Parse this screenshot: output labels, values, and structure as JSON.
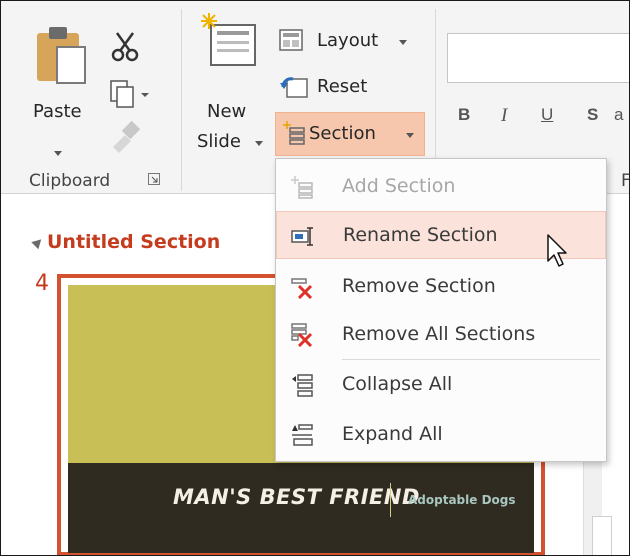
{
  "ribbon": {
    "clipboard": {
      "paste_label": "Paste",
      "group_label": "Clipboard"
    },
    "slides": {
      "new_slide_label_line1": "New",
      "new_slide_label_line2": "Slide",
      "layout_label": "Layout",
      "reset_label": "Reset",
      "section_label": "Section"
    },
    "font": {
      "bold_label": "B",
      "italic_label": "I",
      "underline_label": "U",
      "strike_label": "S",
      "group_partial": "F",
      "partial_char": "a"
    }
  },
  "section_menu": {
    "items": [
      {
        "label": "Add Section",
        "enabled": false,
        "icon": "add-section-icon"
      },
      {
        "label": "Rename Section",
        "enabled": true,
        "icon": "rename-section-icon",
        "hover": true
      },
      {
        "label": "Remove Section",
        "enabled": true,
        "icon": "remove-section-icon"
      },
      {
        "label": "Remove All Sections",
        "enabled": true,
        "icon": "remove-all-sections-icon"
      },
      {
        "label": "Collapse All",
        "enabled": true,
        "icon": "collapse-all-icon"
      },
      {
        "label": "Expand All",
        "enabled": true,
        "icon": "expand-all-icon"
      }
    ]
  },
  "slides_pane": {
    "section_title": "Untitled Section",
    "slide_number": "4",
    "slide_title": "MAN'S BEST FRIEND",
    "slide_subtitle": "Adoptable Dogs"
  },
  "colors": {
    "accent": "#d35230",
    "section_title": "#c43b1d",
    "hover_bg": "#fbe3dc",
    "section_button_bg": "#f6c7ad"
  }
}
